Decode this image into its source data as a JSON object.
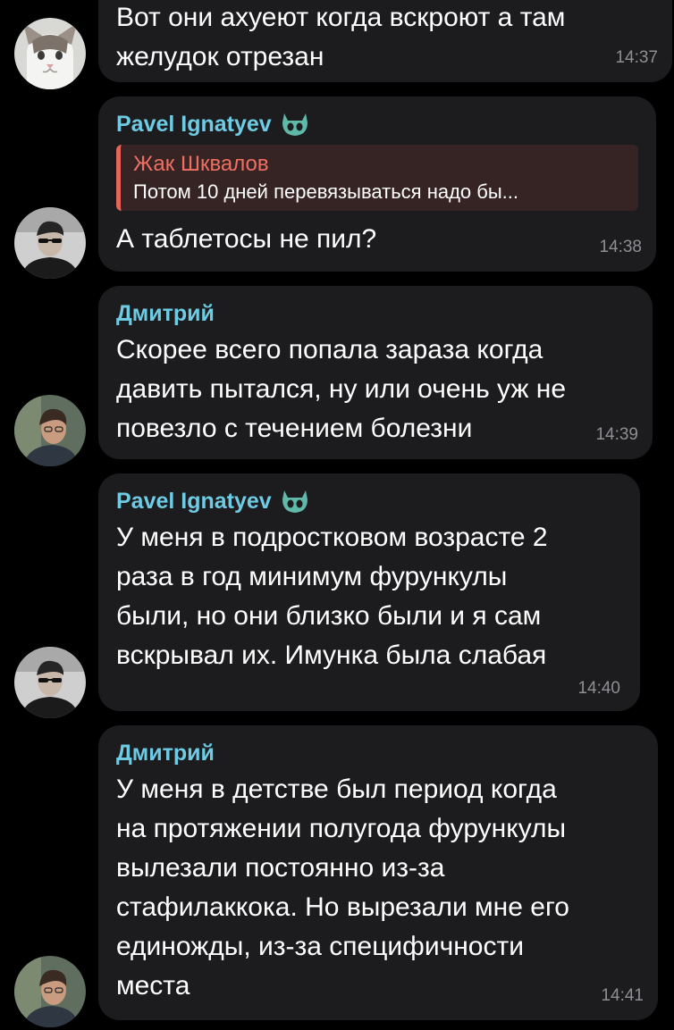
{
  "colors": {
    "background": "#000000",
    "bubble": "#1c1c1e",
    "text": "#ffffff",
    "time": "#8e8e93",
    "name_pavel": "#6ecbe3",
    "name_dmitry": "#6ecbe3",
    "reply_accent": "#ef6f62"
  },
  "messages": [
    {
      "avatar": "cat-avatar",
      "text": "Вот они ахуеют когда вскроют а там\nжелудок отрезан",
      "time": "14:37"
    },
    {
      "avatar": "pavel-avatar",
      "sender": "Pavel Ignatyev",
      "badge": "custom-emoji-badge-icon",
      "reply": {
        "author": "Жак Шквалов",
        "text": "Потом 10 дней перевязываться надо бы..."
      },
      "text": "А таблетосы не пил?",
      "time": "14:38"
    },
    {
      "avatar": "dmitry-avatar",
      "sender": "Дмитрий",
      "text": "Скорее всего попала зараза когда\nдавить пытался, ну или очень уж не\nповезло с течением болезни",
      "time": "14:39"
    },
    {
      "avatar": "pavel-avatar",
      "sender": "Pavel Ignatyev",
      "badge": "custom-emoji-badge-icon",
      "text": "У меня в подростковом возрасте 2\nраза в год минимум фурункулы\nбыли, но они близко были и я сам\nвскрывал их. Имунка была слабая",
      "time": "14:40"
    },
    {
      "avatar": "dmitry-avatar",
      "sender": "Дмитрий",
      "text": "У меня в детстве был период когда\nна протяжении полугода фурункулы\nвылезали постоянно из-за\nстафилаккока. Но вырезали мне его\nединожды, из-за специфичности\nместа",
      "time": "14:41"
    }
  ]
}
